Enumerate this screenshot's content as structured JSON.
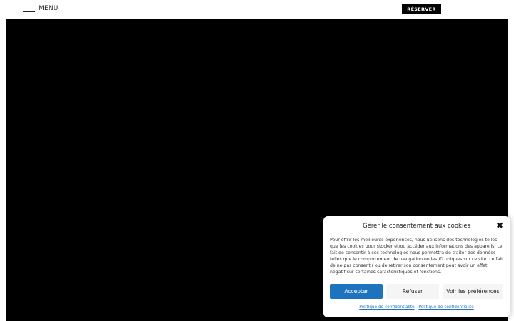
{
  "header": {
    "menu_label": "MENU",
    "reserve_label": "RÉSERVER"
  },
  "cookie_dialog": {
    "title": "Gérer le consentement aux cookies",
    "close_glyph": "✖",
    "body": "Pour offrir les meilleures expériences, nous utilisons des technologies telles que les cookies pour stocker et/ou accéder aux informations des appareils. Le fait de consentir à ces technologies nous permettra de traiter des données telles que le comportement de navigation ou les ID uniques sur ce site. Le fait de ne pas consentir ou de retirer son consentement peut avoir un effet négatif sur certaines caractéristiques et fonctions.",
    "accept_label": "Accepter",
    "refuse_label": "Refuser",
    "preferences_label": "Voir les préférences",
    "links": [
      "Politique de confidentialité",
      "Politique de confidentialité"
    ]
  },
  "colors": {
    "accent": "#1e73be",
    "hero_background": "#000000"
  }
}
